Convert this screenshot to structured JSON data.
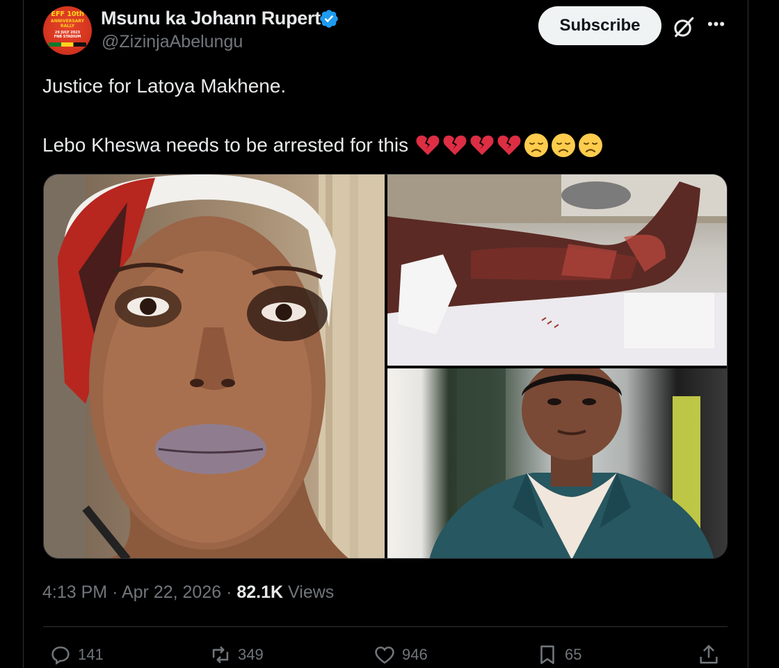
{
  "author": {
    "name": "Msunu ka Johann Rupert",
    "handle": "@ZizinjaAbelungu",
    "avatar_text": {
      "line1": "EFF 10th",
      "line2": "ANNIVERSARY RALLY",
      "line3": "29 JULY 2023",
      "line4": "FNB STADIUM"
    }
  },
  "header": {
    "subscribe_label": "Subscribe",
    "grok_icon": "grok-icon",
    "more_icon": "more-icon"
  },
  "tweet": {
    "line1": "Justice for Latoya Makhene.",
    "line2": "Lebo Kheswa needs to be arrested for this",
    "emojis": [
      "broken-heart",
      "broken-heart",
      "broken-heart",
      "broken-heart",
      "disappointed-face",
      "disappointed-face",
      "disappointed-face"
    ]
  },
  "media": [
    {
      "name": "face-photo"
    },
    {
      "name": "leg-photo"
    },
    {
      "name": "portrait-photo"
    }
  ],
  "meta": {
    "time": "4:13 PM",
    "sep": "·",
    "date": "Apr 22, 2026",
    "views_count": "82.1K",
    "views_label": "Views"
  },
  "actions": {
    "replies": "141",
    "reposts": "349",
    "likes": "946",
    "bookmarks": "65"
  },
  "colors": {
    "background": "#000000",
    "text": "#e7e9ea",
    "muted": "#71767b",
    "verified": "#1d9bf0",
    "border": "#2f3336"
  }
}
